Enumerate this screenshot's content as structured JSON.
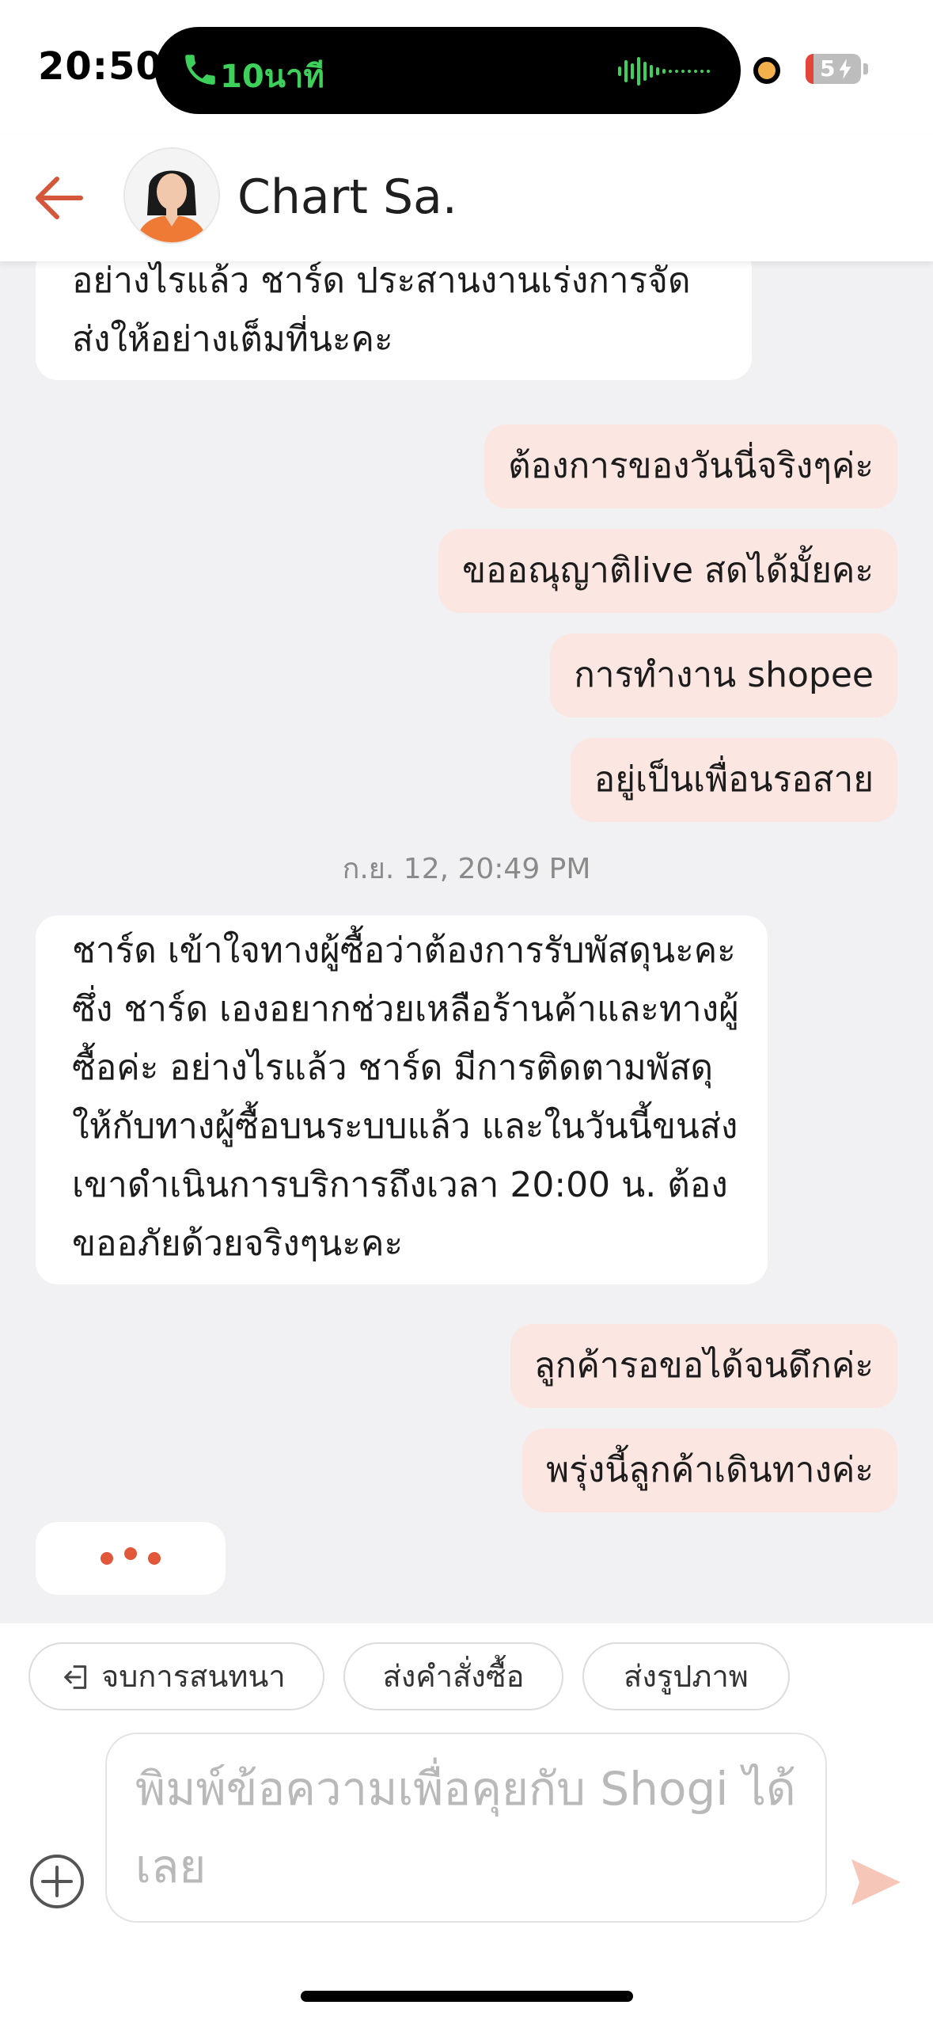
{
  "status_bar": {
    "time": "20:50",
    "call_text": "10นาที",
    "battery": "5"
  },
  "header": {
    "title": "Chart Sa."
  },
  "messages": [
    {
      "side": "in",
      "text": "อย่างไรแล้ว ชาร์ด ประสานงานเร่งการจัดส่งให้อย่างเต็มที่นะคะ"
    },
    {
      "side": "out",
      "text": "ต้องการของวันนี่จริงๆค่ะ"
    },
    {
      "side": "out",
      "text": "ขออณุญาติlive สดได้มั้ยคะ"
    },
    {
      "side": "out",
      "text": "การทำงาน shopee"
    },
    {
      "side": "out",
      "text": "อยู่เป็นเพื่อนรอสาย"
    },
    {
      "side": "timestamp",
      "text": "ก.ย. 12, 20:49 PM"
    },
    {
      "side": "in",
      "text": "ชาร์ด เข้าใจทางผู้ซื้อว่าต้องการรับพัสดุนะคะ ซึ่ง ชาร์ด เองอยากช่วยเหลือร้านค้าและทางผู้ซื้อค่ะ อย่างไรแล้ว ชาร์ด มีการติดตามพัสดุให้กับทางผู้ซื้อบนระบบแล้ว และในวันนี้ขนส่งเขาดำเนินการบริการถึงเวลา 20:00 น. ต้องขออภัยด้วยจริงๆนะคะ"
    },
    {
      "side": "out",
      "text": "ลูกค้ารอขอได้จนดึกค่ะ"
    },
    {
      "side": "out",
      "text": "พรุ่งนี้ลูกค้าเดินทางค่ะ"
    }
  ],
  "quick_actions": {
    "end_chat": "จบการสนทนา",
    "send_order": "ส่งคำสั่งซื้อ",
    "send_image": "ส่งรูปภาพ"
  },
  "composer": {
    "placeholder": "พิมพ์ข้อความเพื่อคุยกับ Shogi ได้เลย"
  },
  "colors": {
    "accent": "#e0573a",
    "outgoing_bubble": "#fbe6e1",
    "chat_background": "#f1f1f3",
    "call_green": "#3dd15b"
  }
}
